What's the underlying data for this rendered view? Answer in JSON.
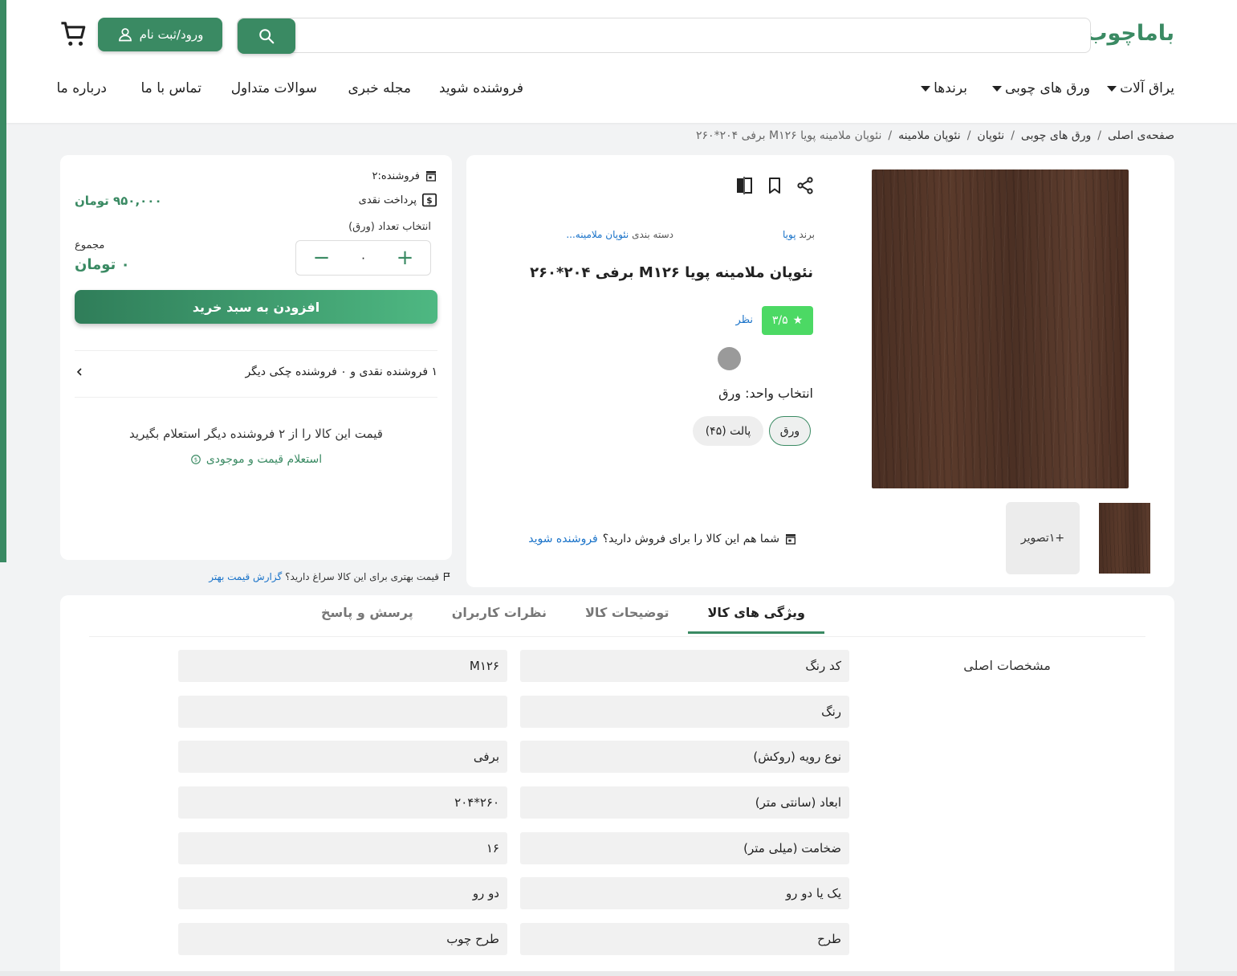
{
  "header": {
    "logo": "باماچوب",
    "search_placeholder": "",
    "login_label": "ورود/ثبت نام",
    "nav": [
      {
        "label": "یراق آلات",
        "has_caret": true
      },
      {
        "label": "ورق های چوبی",
        "has_caret": true
      },
      {
        "label": "برندها",
        "has_caret": true
      },
      {
        "label": "فروشنده شوید",
        "has_caret": false
      },
      {
        "label": "مجله خبری",
        "has_caret": false
      },
      {
        "label": "سوالات متداول",
        "has_caret": false
      },
      {
        "label": "تماس با ما",
        "has_caret": false
      },
      {
        "label": "درباره ما",
        "has_caret": false
      }
    ]
  },
  "breadcrumb": [
    "صفحه‌ی اصلی",
    "ورق های چوبی",
    "نئوپان",
    "نئوپان ملامینه",
    "نئوپان ملامینه پویا M۱۲۶ برفی ۲۰۴*۲۶۰"
  ],
  "product": {
    "brand_label": "برند",
    "brand_value": "پویا",
    "category_label": "دسته بندی",
    "category_value": "نئوپان ملامینه...",
    "title": "نئوپان ملامینه پویا M۱۲۶ برفی ۲۰۴*۲۶۰",
    "rating": "۳/۵",
    "reviews_label": "نظر",
    "unit_label": "انتخاب واحد: ورق",
    "units": [
      "ورق",
      "پالت (۴۵)"
    ],
    "more_images_label": "+۱تصویر",
    "sell_text": "شما هم این کالا را برای فروش دارید؟",
    "sell_link": "فروشنده شوید"
  },
  "buy": {
    "seller_text": "فروشنده:۲",
    "payment_text": "پرداخت نقدی",
    "price": "۹۵۰,۰۰۰ تومان",
    "qty_label": "انتخاب تعداد (ورق)",
    "qty_value": "۰",
    "total_label": "مجموع",
    "total_value": "۰ تومان",
    "add_to_cart": "افزودن به سبد خرید",
    "sellers_summary": "۱ فروشنده نقدی و ۰ فروشنده چکی دیگر",
    "inquiry_text": "قیمت این کالا را از ۲ فروشنده دیگر استعلام بگیرید",
    "inquiry_link": "استعلام قیمت و موجودی",
    "report_text": "قیمت بهتری برای این کالا سراغ دارید؟",
    "report_link": "گزارش قیمت بهتر"
  },
  "tabs": [
    "ویژگی های کالا",
    "توضیحات کالا",
    "نظرات کاربران",
    "پرسش و پاسخ"
  ],
  "specs": {
    "section_title": "مشخصات اصلی",
    "rows": [
      {
        "key": "کد رنگ",
        "value": "M۱۲۶"
      },
      {
        "key": "رنگ",
        "value": ""
      },
      {
        "key": "نوع رویه (روکش)",
        "value": "برفی"
      },
      {
        "key": "ابعاد (سانتی متر)",
        "value": "۲۶۰*۲۰۴"
      },
      {
        "key": "ضخامت (میلی متر)",
        "value": "۱۶"
      },
      {
        "key": "یک یا دو رو",
        "value": "دو رو"
      },
      {
        "key": "طرح",
        "value": "طرح چوب"
      }
    ]
  },
  "colors": {
    "brand": "#3a8a63",
    "rating": "#4cd964",
    "link": "#1a73c9"
  }
}
